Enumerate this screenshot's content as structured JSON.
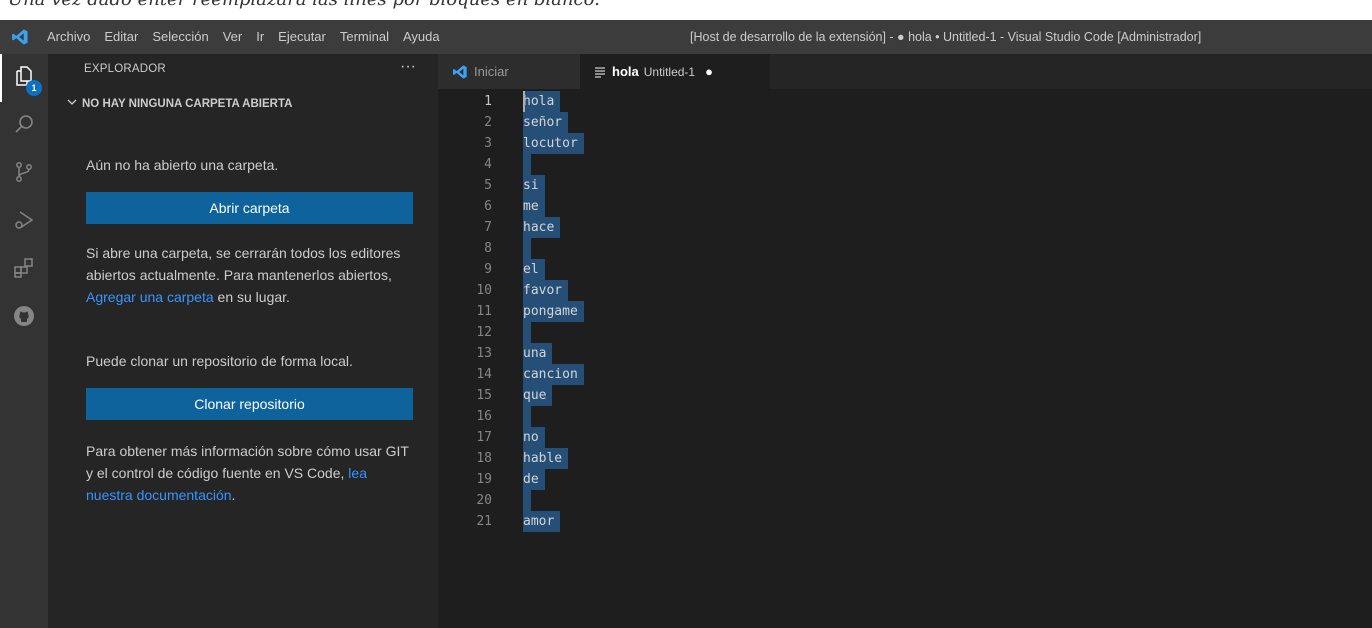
{
  "caption": "Una vez dado enter reemplazará las lines por bloques en blanco:",
  "titlebar": {
    "menu": [
      "Archivo",
      "Editar",
      "Selección",
      "Ver",
      "Ir",
      "Ejecutar",
      "Terminal",
      "Ayuda"
    ],
    "window_title": "[Host de desarrollo de la extensión] - ● hola • Untitled-1 - Visual Studio Code [Administrador]"
  },
  "activity_bar": {
    "items": [
      "files-icon",
      "search-icon",
      "source-control-icon",
      "run-debug-icon",
      "extensions-icon",
      "github-icon"
    ],
    "badge": "1"
  },
  "sidebar": {
    "header": "EXPLORADOR",
    "more": "···",
    "section_title": "NO HAY NINGUNA CARPETA ABIERTA",
    "no_folder_text": "Aún no ha abierto una carpeta.",
    "open_folder_button": "Abrir carpeta",
    "warning_text_1": "Si abre una carpeta, se cerrarán todos los editores abiertos actualmente. Para mantenerlos abiertos,",
    "warning_link": "Agregar una carpeta",
    "warning_text_2": "en su lugar.",
    "clone_text": "Puede clonar un repositorio de forma local.",
    "clone_button": "Clonar repositorio",
    "git_text": "Para obtener más información sobre cómo usar GIT y el control de código fuente en VS Code,",
    "git_link": "lea nuestra documentación",
    "git_end": "."
  },
  "tabs": [
    {
      "label": "Iniciar"
    },
    {
      "label": "hola",
      "description": "Untitled-1",
      "dirty": "●"
    }
  ],
  "editor": {
    "lines": [
      "hola",
      "señor",
      "locutor",
      "",
      "si",
      "me",
      "hace",
      "",
      "el",
      "favor",
      "pongame",
      "",
      "una",
      "cancion",
      "que",
      "",
      "no",
      "hable",
      "de",
      "",
      "amor"
    ],
    "current_line": 1
  },
  "colors": {
    "accent": "#0e639c",
    "link": "#3794ff",
    "selection": "#264f78",
    "badge": "#0e70c0"
  }
}
